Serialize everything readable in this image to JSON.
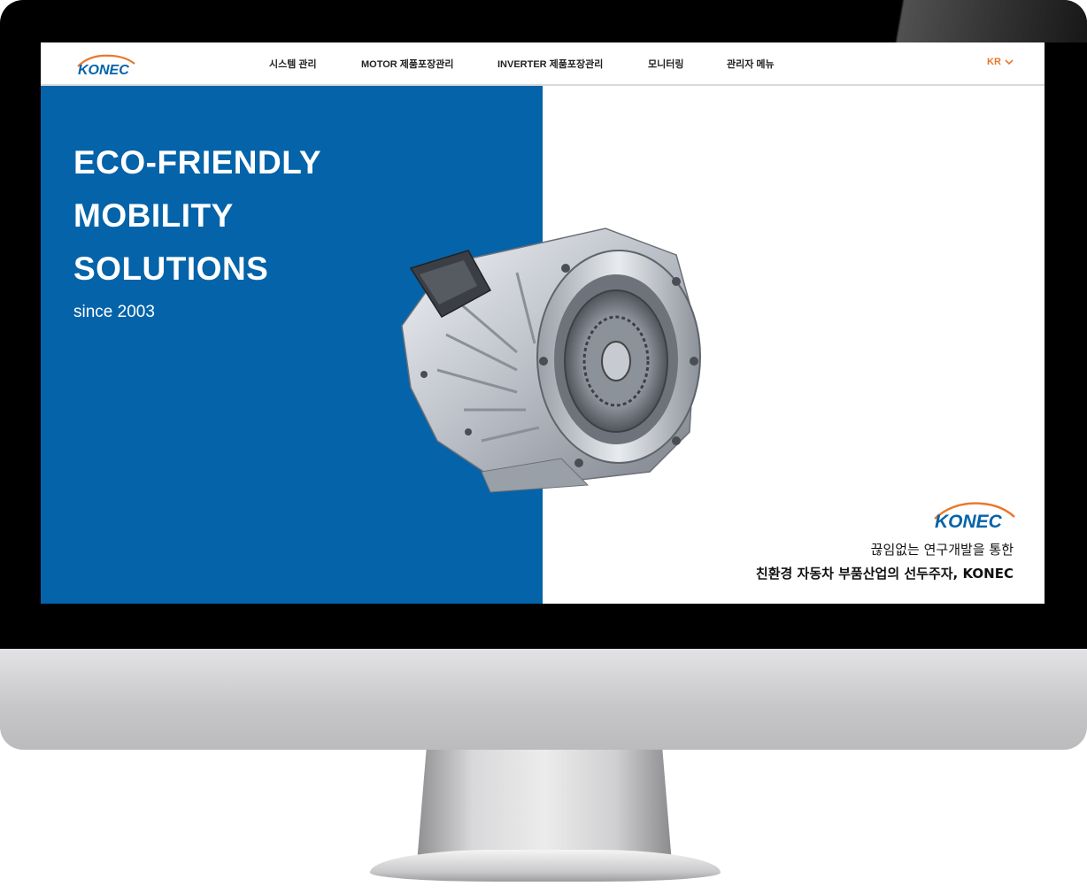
{
  "brand": {
    "name": "KONEC",
    "primary_color": "#0463a9",
    "accent_color": "#e8782a"
  },
  "nav": {
    "items": [
      {
        "label": "시스템 관리"
      },
      {
        "label": "MOTOR 제품포장관리"
      },
      {
        "label": "INVERTER 제품포장관리"
      },
      {
        "label": "모니터링"
      },
      {
        "label": "관리자 메뉴"
      }
    ],
    "language": "KR",
    "language_icon": "chevron-down-icon"
  },
  "hero": {
    "headline": [
      "ECO-FRIENDLY",
      "MOBILITY",
      "SOLUTIONS"
    ],
    "since": "since 2003",
    "image": "ev-motor-gearbox"
  },
  "tagline": {
    "line1": "끊임없는 연구개발을 통한",
    "line2": "친환경 자동차 부품산업의 선두주자, KONEC"
  }
}
